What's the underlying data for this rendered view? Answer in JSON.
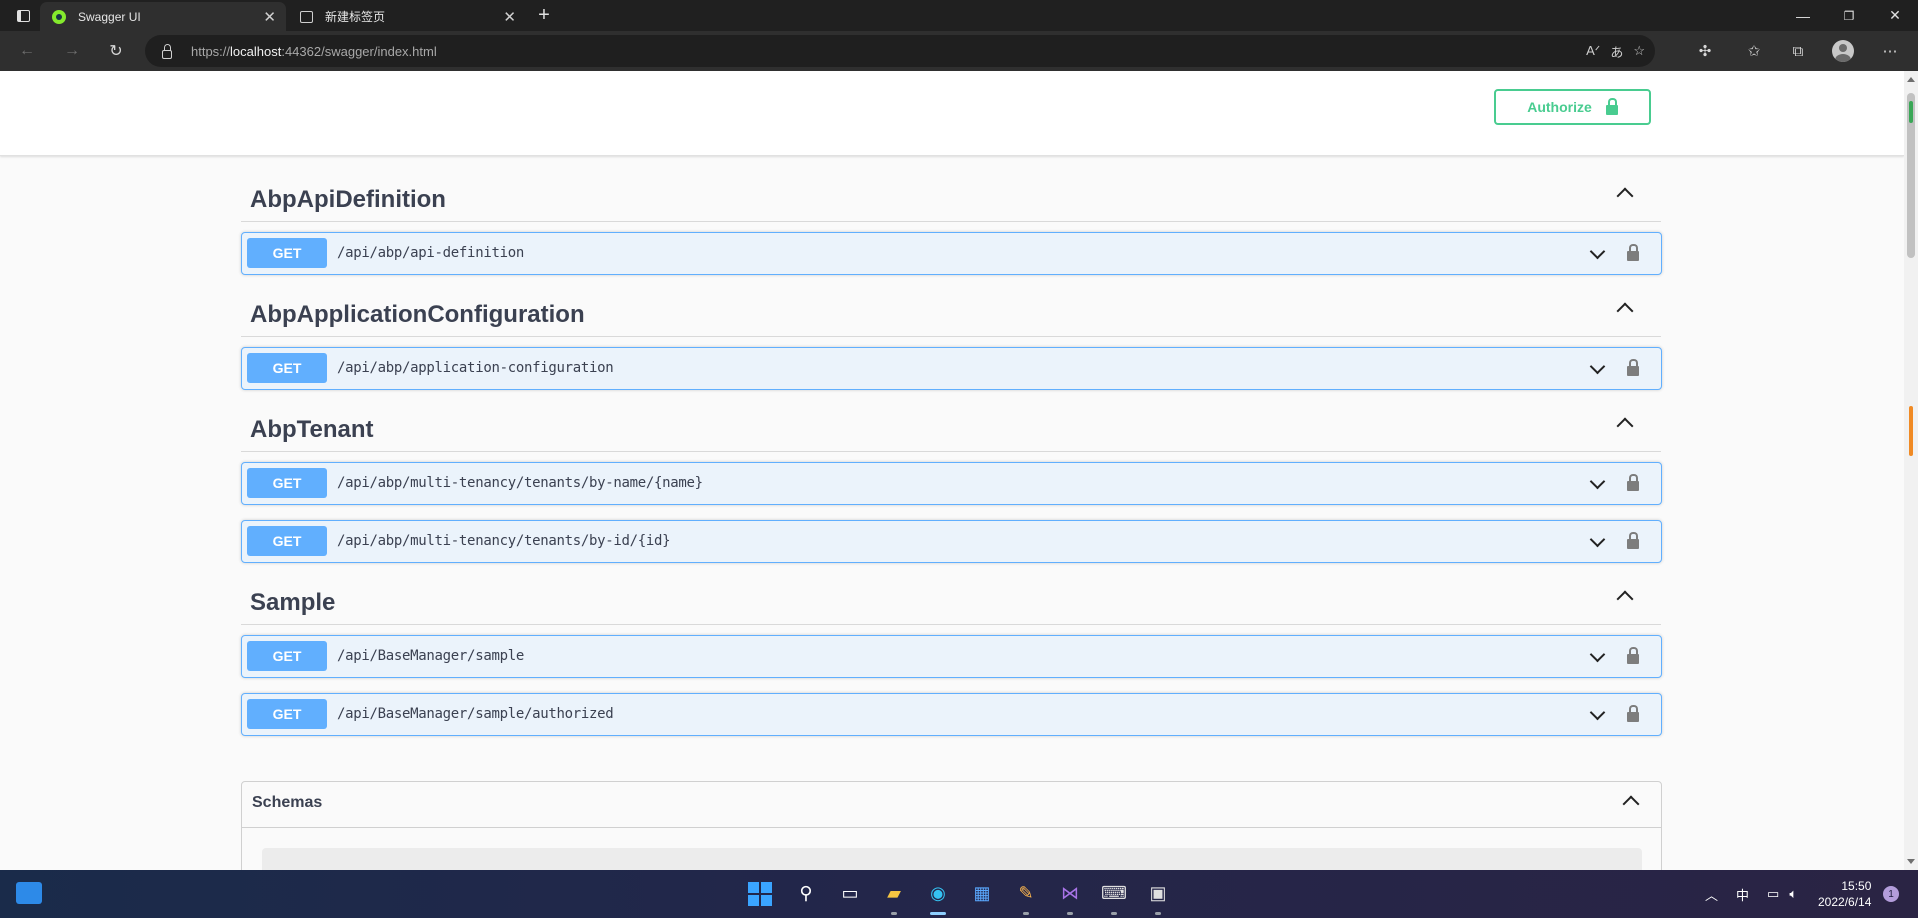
{
  "browser": {
    "tabs": [
      {
        "title": "Swagger UI",
        "active": true
      },
      {
        "title": "新建标签页",
        "active": false
      }
    ],
    "new_tab_label": "+",
    "url_prefix": "https://",
    "url_host": "localhost",
    "url_rest": ":44362/swagger/index.html"
  },
  "swagger": {
    "authorize_label": "Authorize",
    "sections": [
      {
        "name": "AbpApiDefinition",
        "operations": [
          {
            "method": "GET",
            "path": "/api/abp/api-definition"
          }
        ]
      },
      {
        "name": "AbpApplicationConfiguration",
        "operations": [
          {
            "method": "GET",
            "path": "/api/abp/application-configuration"
          }
        ]
      },
      {
        "name": "AbpTenant",
        "operations": [
          {
            "method": "GET",
            "path": "/api/abp/multi-tenancy/tenants/by-name/{name}"
          },
          {
            "method": "GET",
            "path": "/api/abp/multi-tenancy/tenants/by-id/{id}"
          }
        ]
      },
      {
        "name": "Sample",
        "operations": [
          {
            "method": "GET",
            "path": "/api/BaseManager/sample"
          },
          {
            "method": "GET",
            "path": "/api/BaseManager/sample/authorized"
          }
        ]
      }
    ],
    "schemas_label": "Schemas"
  },
  "taskbar": {
    "ime_label": "中",
    "time": "15:50",
    "date": "2022/6/14",
    "notification_count": "1"
  },
  "colors": {
    "get_method": "#61affe",
    "authorize": "#49cc90",
    "tab_bar": "#202020"
  }
}
